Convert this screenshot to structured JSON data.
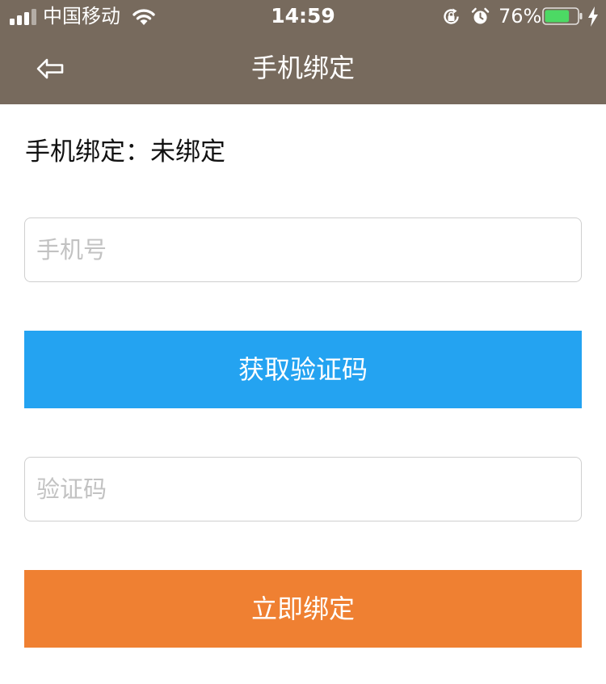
{
  "status_bar": {
    "carrier": "中国移动",
    "time": "14:59",
    "battery_percent": "76%",
    "battery_level": 0.76,
    "icons": [
      "signal-icon",
      "wifi-icon",
      "rotation-lock-icon",
      "alarm-icon",
      "battery-icon",
      "charging-bolt-icon"
    ]
  },
  "nav": {
    "title": "手机绑定",
    "back_icon": "back-arrow-icon"
  },
  "form": {
    "bind_status": "手机绑定：未绑定",
    "phone_placeholder": "手机号",
    "phone_value": "",
    "get_code_label": "获取验证码",
    "code_placeholder": "验证码",
    "code_value": "",
    "bind_label": "立即绑定"
  },
  "colors": {
    "header_bg": "#776a5d",
    "get_code_button": "#24a3f1",
    "bind_button": "#ef8032",
    "battery_fill": "#4cd964"
  }
}
